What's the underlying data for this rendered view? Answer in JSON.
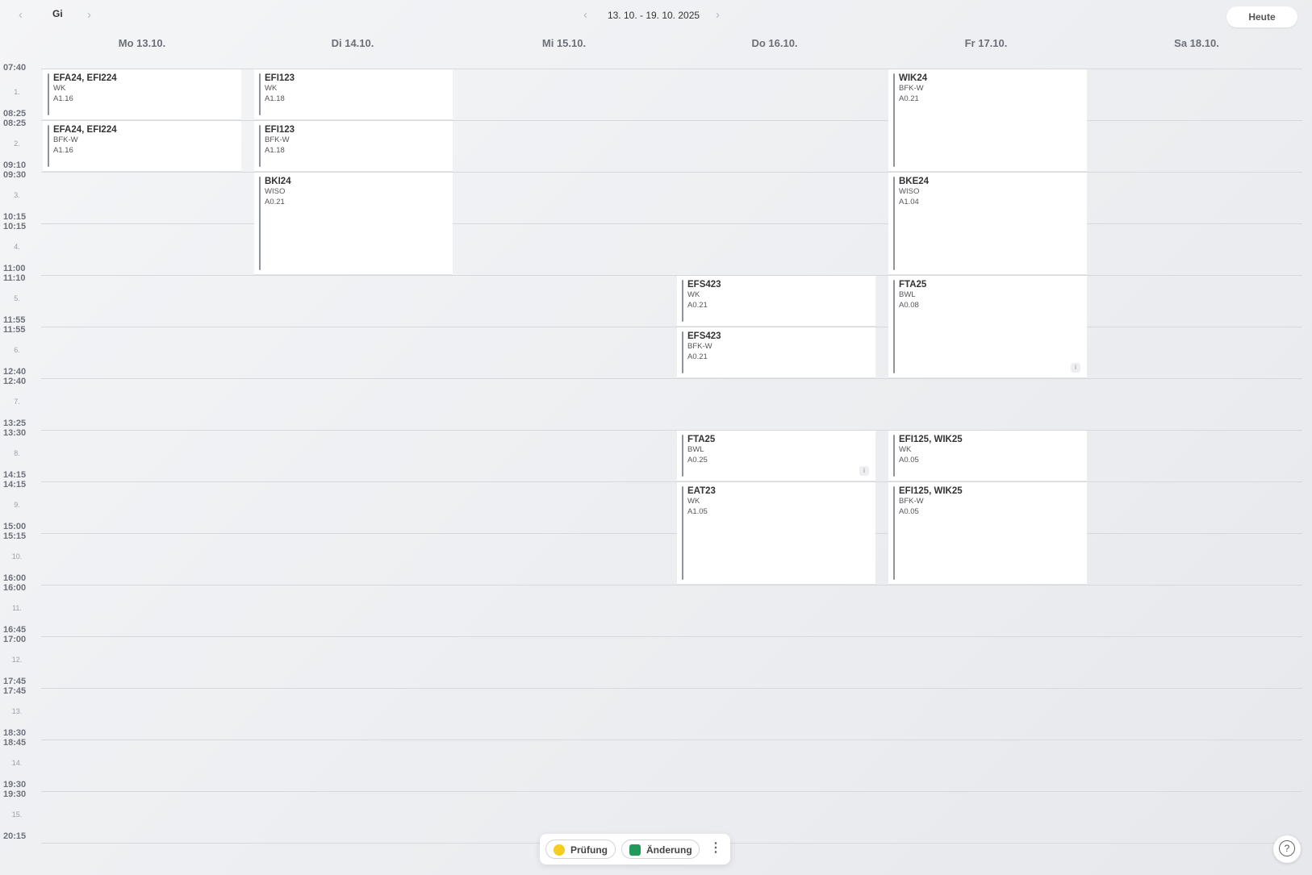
{
  "toolbar": {
    "teacher_prev_icon": "chevron-left-icon",
    "teacher": "Gi",
    "teacher_next_icon": "chevron-right-icon",
    "week_prev_icon": "chevron-left-icon",
    "week_range": "13. 10. - 19. 10. 2025",
    "week_next_icon": "chevron-right-icon",
    "today_label": "Heute"
  },
  "days": [
    "Mo 13.10.",
    "Di 14.10.",
    "Mi 15.10.",
    "Do 16.10.",
    "Fr 17.10.",
    "Sa 18.10."
  ],
  "periods": [
    {
      "label": "1.",
      "start": "07:40",
      "end": "08:25"
    },
    {
      "label": "2.",
      "start": "08:25",
      "end": "09:10"
    },
    {
      "label": "3.",
      "start": "09:30",
      "end": "10:15"
    },
    {
      "label": "4.",
      "start": "10:15",
      "end": "11:00"
    },
    {
      "label": "5.",
      "start": "11:10",
      "end": "11:55"
    },
    {
      "label": "6.",
      "start": "11:55",
      "end": "12:40"
    },
    {
      "label": "7.",
      "start": "12:40",
      "end": "13:25"
    },
    {
      "label": "8.",
      "start": "13:30",
      "end": "14:15"
    },
    {
      "label": "9.",
      "start": "14:15",
      "end": "15:00"
    },
    {
      "label": "10.",
      "start": "15:15",
      "end": "16:00"
    },
    {
      "label": "11.",
      "start": "16:00",
      "end": "16:45"
    },
    {
      "label": "12.",
      "start": "17:00",
      "end": "17:45"
    },
    {
      "label": "13.",
      "start": "17:45",
      "end": "18:30"
    },
    {
      "label": "14.",
      "start": "18:45",
      "end": "19:30"
    },
    {
      "label": "15.",
      "start": "19:30",
      "end": "20:15"
    }
  ],
  "lessons": [
    {
      "day": 0,
      "from": 1,
      "to": 1,
      "class": "EFA24, EFI224",
      "subject": "WK",
      "room": "A1.16"
    },
    {
      "day": 0,
      "from": 2,
      "to": 2,
      "class": "EFA24, EFI224",
      "subject": "BFK-W",
      "room": "A1.16"
    },
    {
      "day": 1,
      "from": 1,
      "to": 1,
      "class": "EFI123",
      "subject": "WK",
      "room": "A1.18"
    },
    {
      "day": 1,
      "from": 2,
      "to": 2,
      "class": "EFI123",
      "subject": "BFK-W",
      "room": "A1.18"
    },
    {
      "day": 1,
      "from": 3,
      "to": 4,
      "class": "BKI24",
      "subject": "WISO",
      "room": "A0.21"
    },
    {
      "day": 3,
      "from": 5,
      "to": 5,
      "class": "EFS423",
      "subject": "WK",
      "room": "A0.21"
    },
    {
      "day": 3,
      "from": 6,
      "to": 6,
      "class": "EFS423",
      "subject": "BFK-W",
      "room": "A0.21"
    },
    {
      "day": 3,
      "from": 8,
      "to": 8,
      "class": "FTA25",
      "subject": "BWL",
      "room": "A0.25",
      "info": true
    },
    {
      "day": 3,
      "from": 9,
      "to": 10,
      "class": "EAT23",
      "subject": "WK",
      "room": "A1.05"
    },
    {
      "day": 4,
      "from": 1,
      "to": 2,
      "class": "WIK24",
      "subject": "BFK-W",
      "room": "A0.21"
    },
    {
      "day": 4,
      "from": 3,
      "to": 4,
      "class": "BKE24",
      "subject": "WISO",
      "room": "A1.04"
    },
    {
      "day": 4,
      "from": 5,
      "to": 6,
      "class": "FTA25",
      "subject": "BWL",
      "room": "A0.08",
      "info": true
    },
    {
      "day": 4,
      "from": 8,
      "to": 8,
      "class": "EFI125, WIK25",
      "subject": "WK",
      "room": "A0.05"
    },
    {
      "day": 4,
      "from": 9,
      "to": 10,
      "class": "EFI125, WIK25",
      "subject": "BFK-W",
      "room": "A0.05"
    }
  ],
  "legend": {
    "exam_label": "Prüfung",
    "exam_color": "#f5cd1c",
    "change_label": "Änderung",
    "change_color": "#1f9a5b",
    "more_icon": "more-vertical-icon",
    "more_glyph": "⋮"
  },
  "help": {
    "icon": "help-icon",
    "glyph": "?"
  }
}
